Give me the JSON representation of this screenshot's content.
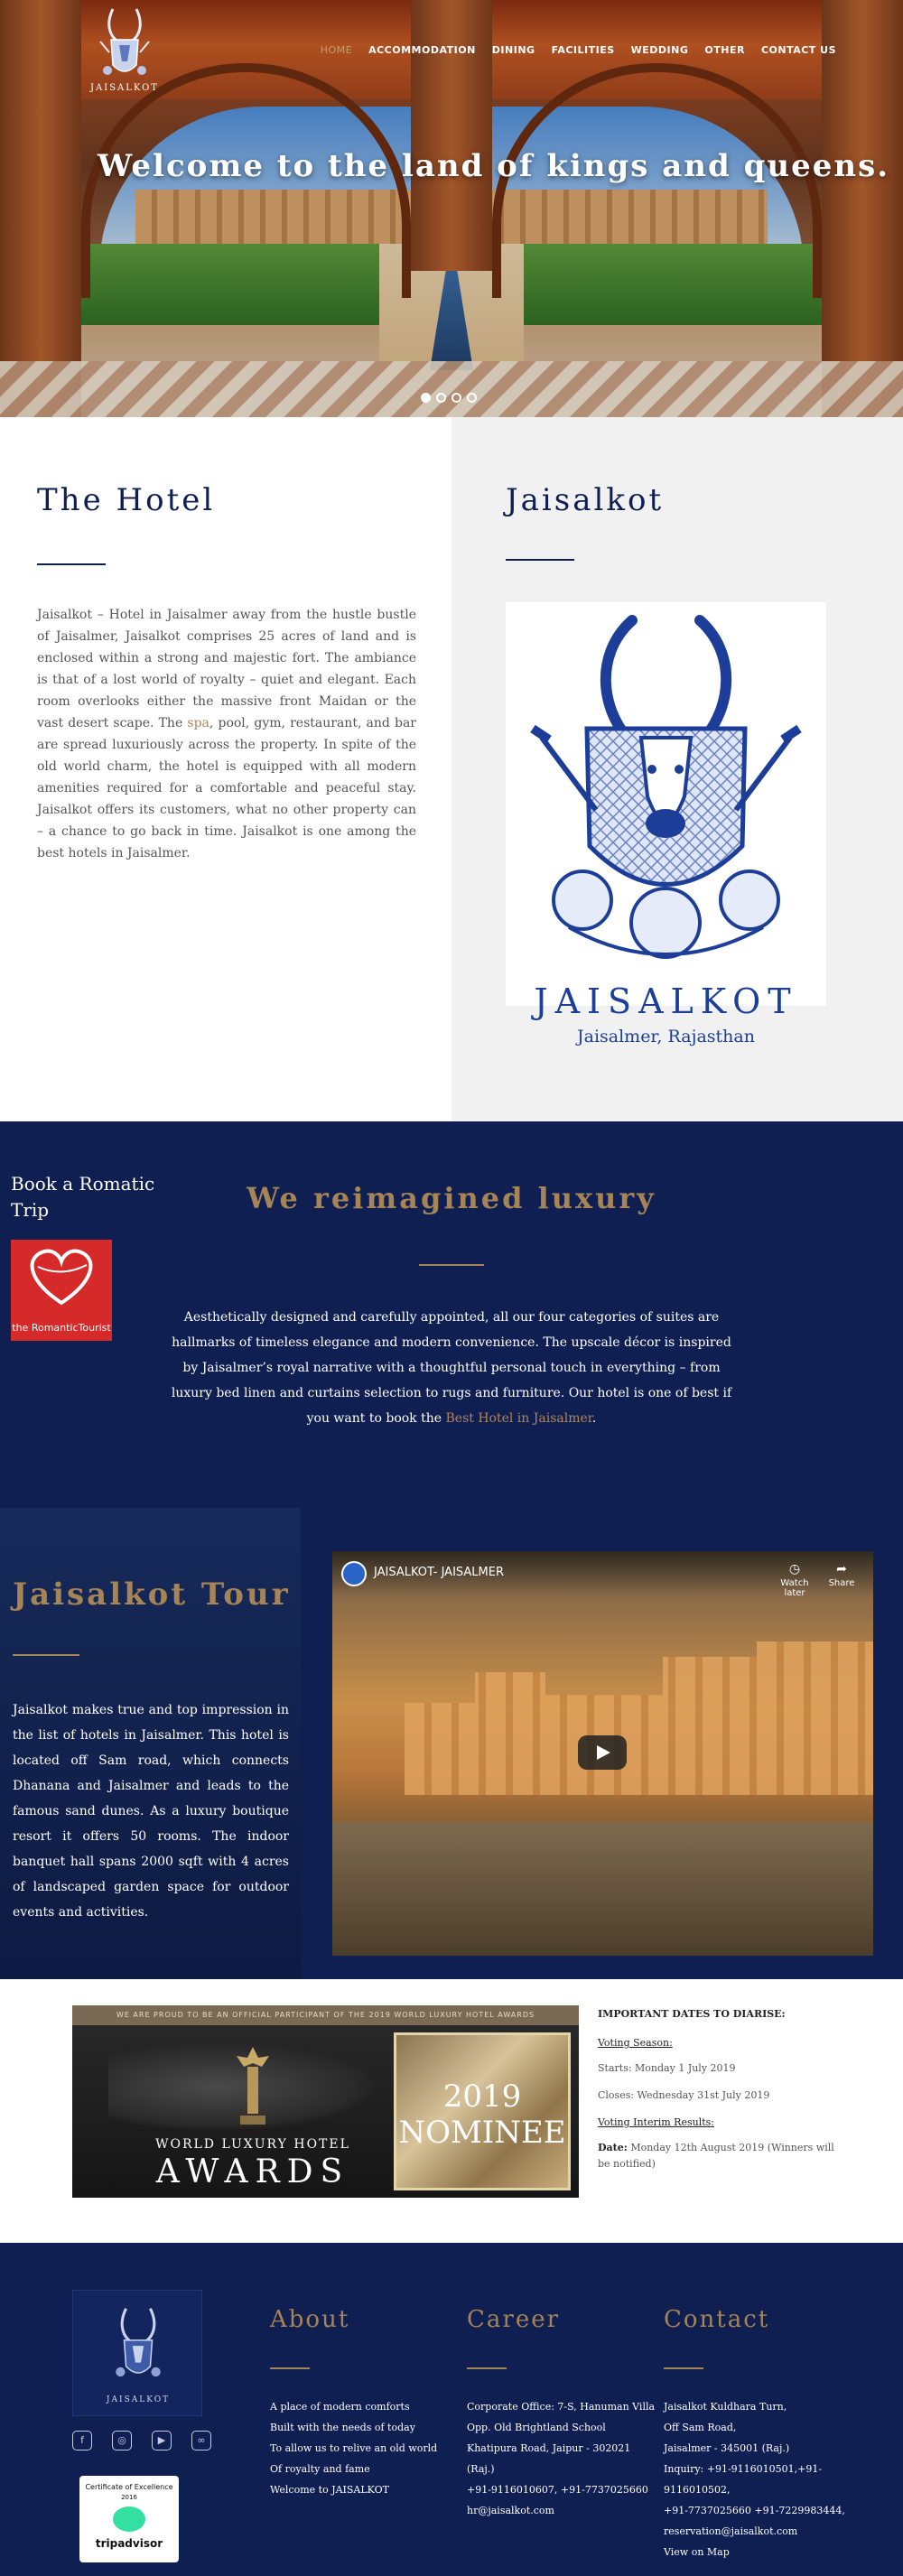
{
  "brand": {
    "logo_text": "JAISALKOT"
  },
  "nav": {
    "items": [
      {
        "label": "HOME",
        "active": true
      },
      {
        "label": "ACCOMMODATION"
      },
      {
        "label": "DINING"
      },
      {
        "label": "FACILITIES"
      },
      {
        "label": "WEDDING"
      },
      {
        "label": "OTHER"
      },
      {
        "label": "CONTACT US"
      }
    ]
  },
  "hero": {
    "title": "Welcome to the land of kings and queens.",
    "slide_count": 4,
    "active_slide": 1
  },
  "hotel": {
    "heading": "The Hotel",
    "text_before": "Jaisalkot – Hotel in Jaisalmer away from the hustle bustle of Jaisalmer, Jaisalkot comprises 25 acres of land and is enclosed within a strong and majestic fort. The ambiance is that of a lost world of royalty – quiet and elegant. Each room overlooks either the massive front Maidan or the vast desert scape. The ",
    "link": "spa",
    "text_after": ", pool, gym, restaurant, and bar are spread luxuriously across the property. In spite of the old world charm, the hotel is equipped with all modern amenities required for a comfortable and peaceful stay. Jaisalkot offers its customers, what no other property can – a chance to go back in time. Jaisalkot is one among the best hotels in Jaisalmer."
  },
  "brand_panel": {
    "heading": "Jaisalkot",
    "wordmark": "JAISALKOT",
    "location": "Jaisalmer, Rajasthan"
  },
  "luxury": {
    "book_title": "Book a Romatic Trip",
    "badge_text": "the RomanticTourist",
    "heading": "We reimagined luxury",
    "text": "Aesthetically designed and carefully appointed, all our four categories of suites are hallmarks of timeless elegance and modern convenience. The upscale décor is inspired by Jaisalmer’s royal narrative with a thoughtful personal touch in everything – from luxury bed linen and curtains selection to rugs and furniture. Our hotel is one of best if you want to book the ",
    "link": "Best Hotel in Jaisalmer",
    "text_end": "."
  },
  "tour": {
    "heading": "Jaisalkot Tour",
    "text": "Jaisalkot makes true and top impression in the list of hotels in Jaisalmer. This hotel is located off Sam road, which connects Dhanana and Jaisalmer and leads to the famous sand dunes. As a luxury boutique resort it offers 50 rooms. The indoor banquet hall spans 2000 sqft with 4 acres of landscaped garden space for outdoor events and activities.",
    "video": {
      "title": "JAISALKOT- JAISALMER",
      "watch_later": "Watch later",
      "share": "Share"
    }
  },
  "awards": {
    "banner_top": "WE ARE PROUD TO BE AN OFFICIAL PARTICIPANT OF THE 2019 WORLD LUXURY HOTEL AWARDS",
    "banner_line1": "WORLD LUXURY HOTEL",
    "banner_line2": "AWARDS",
    "year": "2019",
    "nominee": "NOMINEE",
    "dates_heading": "IMPORTANT DATES TO DIARISE:",
    "voting_season": "Voting Season:",
    "starts": "Starts: Monday 1 July 2019",
    "closes": "Closes: Wednesday 31st July 2019",
    "interim": "Voting Interim Results:",
    "date_label": "Date:",
    "date_value": "Monday 12th August 2019 (Winners will be notified)"
  },
  "footer": {
    "logo_text": "JAISALKOT",
    "socials": [
      "facebook-icon",
      "instagram-icon",
      "youtube-icon",
      "tripadvisor-icon"
    ],
    "certificate": {
      "line1": "Certificate of Excellence",
      "line2": "2016",
      "name": "tripadvisor"
    },
    "about": {
      "heading": "About",
      "lines": [
        "A place of modern comforts",
        "Built with the needs of today",
        "To allow us to relive an old world",
        "Of royalty and fame",
        "Welcome to JAISALKOT"
      ]
    },
    "career": {
      "heading": "Career",
      "lines": [
        "Corporate Office: 7-S, Hanuman Villa",
        "Opp. Old Brightland School",
        "Khatipura Road, Jaipur - 302021 (Raj.)",
        "+91-9116010607, +91-7737025660",
        "hr@jaisalkot.com"
      ]
    },
    "contact": {
      "heading": "Contact",
      "lines": [
        "Jaisalkot Kuldhara Turn,",
        "Off Sam Road,",
        "Jaisalmer - 345001 (Raj.)",
        "Inquiry: +91-9116010501,+91-9116010502,",
        "+91-7737025660 +91-7229983444,",
        "reservation@jaisalkot.com",
        "View on Map"
      ]
    }
  },
  "colors": {
    "navy": "#0f1f52",
    "gold": "#a68456",
    "brand_blue": "#1d3e98"
  }
}
